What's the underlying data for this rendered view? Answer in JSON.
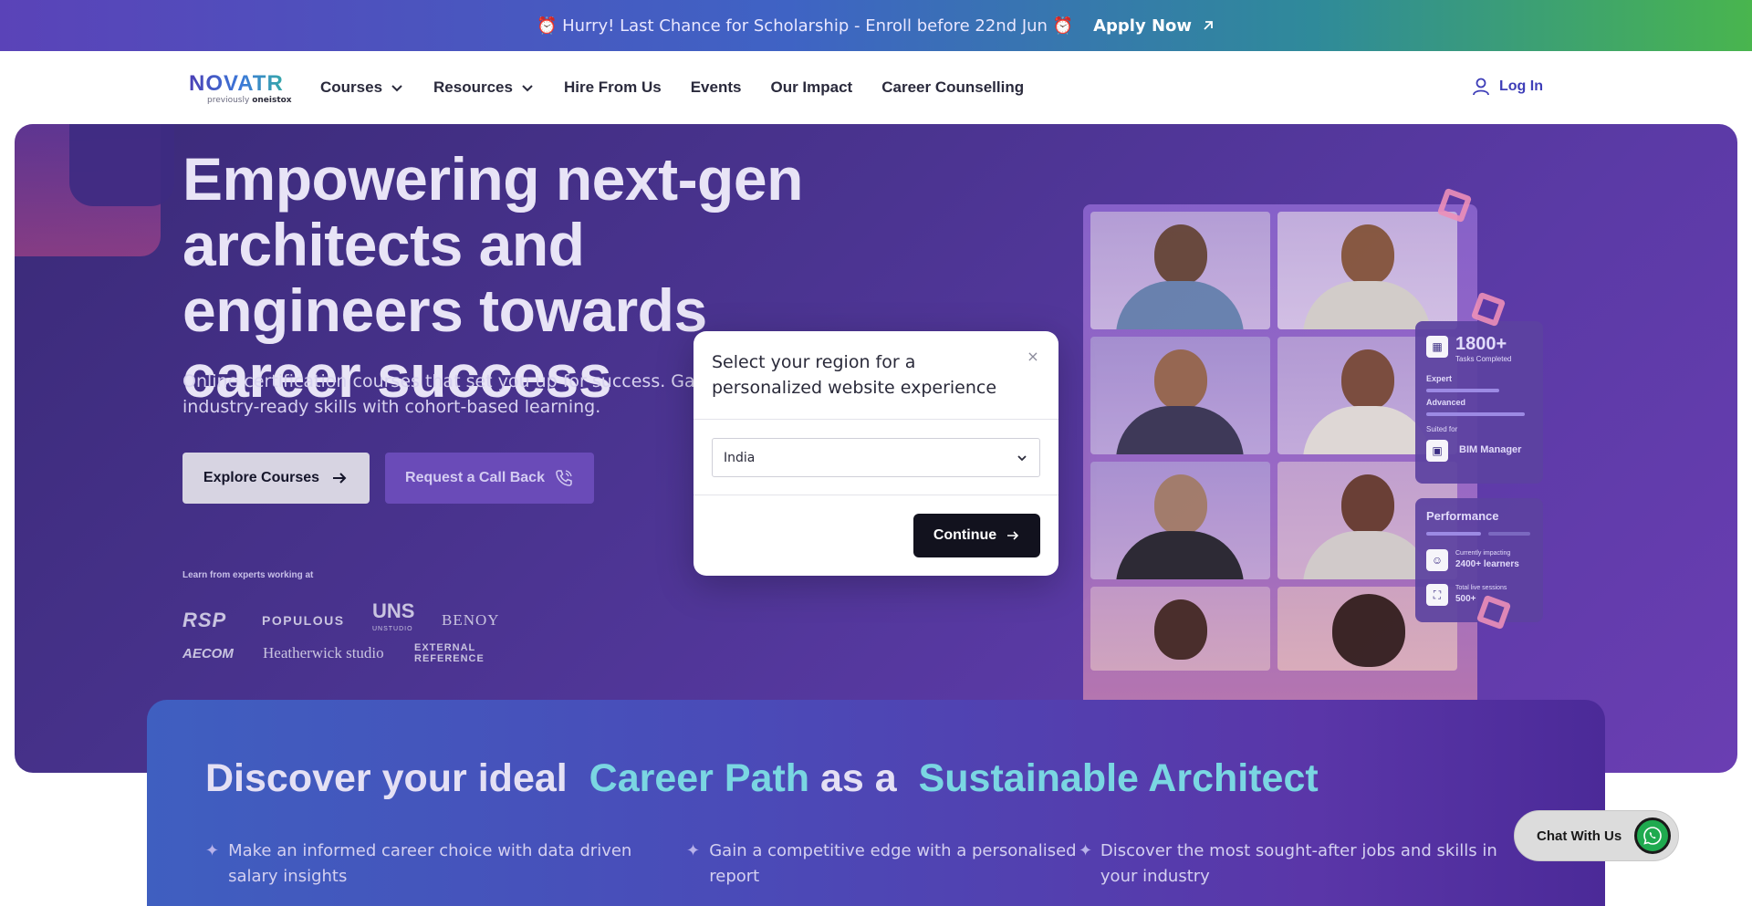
{
  "banner": {
    "promo_text": "⏰ Hurry! Last Chance for Scholarship - Enroll before 22nd Jun ⏰",
    "apply_label": "Apply Now"
  },
  "logo": {
    "word": "NOVATR",
    "sub_prefix": "previously",
    "sub_brand": "oneistox"
  },
  "nav": {
    "items": [
      {
        "label": "Courses",
        "has_dropdown": true
      },
      {
        "label": "Resources",
        "has_dropdown": true
      },
      {
        "label": "Hire From Us",
        "has_dropdown": false
      },
      {
        "label": "Events",
        "has_dropdown": false
      },
      {
        "label": "Our Impact",
        "has_dropdown": false
      },
      {
        "label": "Career Counselling",
        "has_dropdown": false
      }
    ],
    "login_label": "Log In"
  },
  "hero": {
    "title": "Empowering next-gen architects and engineers towards career success",
    "subtitle": "Online certification courses that set you up for success. Gain industry-ready skills with cohort-based learning.",
    "explore_label": "Explore Courses",
    "callback_label": "Request a Call Back",
    "experts_label": "Learn from experts working at",
    "firms": {
      "rsp": "RSP",
      "populous": "POPULOUS",
      "uns": "UNS",
      "uns_sub": "UNSTUDIO",
      "benoy": "BENOY",
      "aecom": "AECOM",
      "heatherwick": "Heatherwick studio",
      "external_line1": "EXTERNAL",
      "external_line2": "REFERENCE"
    },
    "card_tasks": {
      "count": "1800+",
      "count_label": "Tasks Completed",
      "level1": "Expert",
      "level2": "Advanced",
      "suited_label": "Suited for",
      "role": "BIM Manager"
    },
    "card_perf": {
      "title": "Performance",
      "impact_label": "Currently impacting",
      "impact_value": "2400+ learners",
      "sessions_label": "Total live sessions",
      "sessions_value": "500+"
    }
  },
  "modal": {
    "title": "Select your region for a personalized website experience",
    "close_label": "×",
    "region_value": "India",
    "continue_label": "Continue"
  },
  "career": {
    "heading_part1": "Discover your ideal",
    "heading_hl1": "Career Path",
    "heading_part2": "as a",
    "heading_hl2": "Sustainable Architect",
    "points": [
      "Make an informed career choice with data driven salary insights",
      "Gain a competitive edge with a personalised report",
      "Discover the most sought-after jobs and skills in your industry"
    ]
  },
  "chat": {
    "label": "Chat With Us"
  },
  "colors": {
    "accent": "#3e3eb8",
    "hero_bg": "#4b3491",
    "highlight": "#7ad6e2",
    "button_dark": "#12121e",
    "whatsapp": "#1faa4f"
  },
  "icons": [
    "arrow-up-right-icon",
    "chevron-down-icon",
    "user-icon",
    "arrow-right-icon",
    "phone-icon",
    "close-icon",
    "pin-icon",
    "whatsapp-icon"
  ]
}
